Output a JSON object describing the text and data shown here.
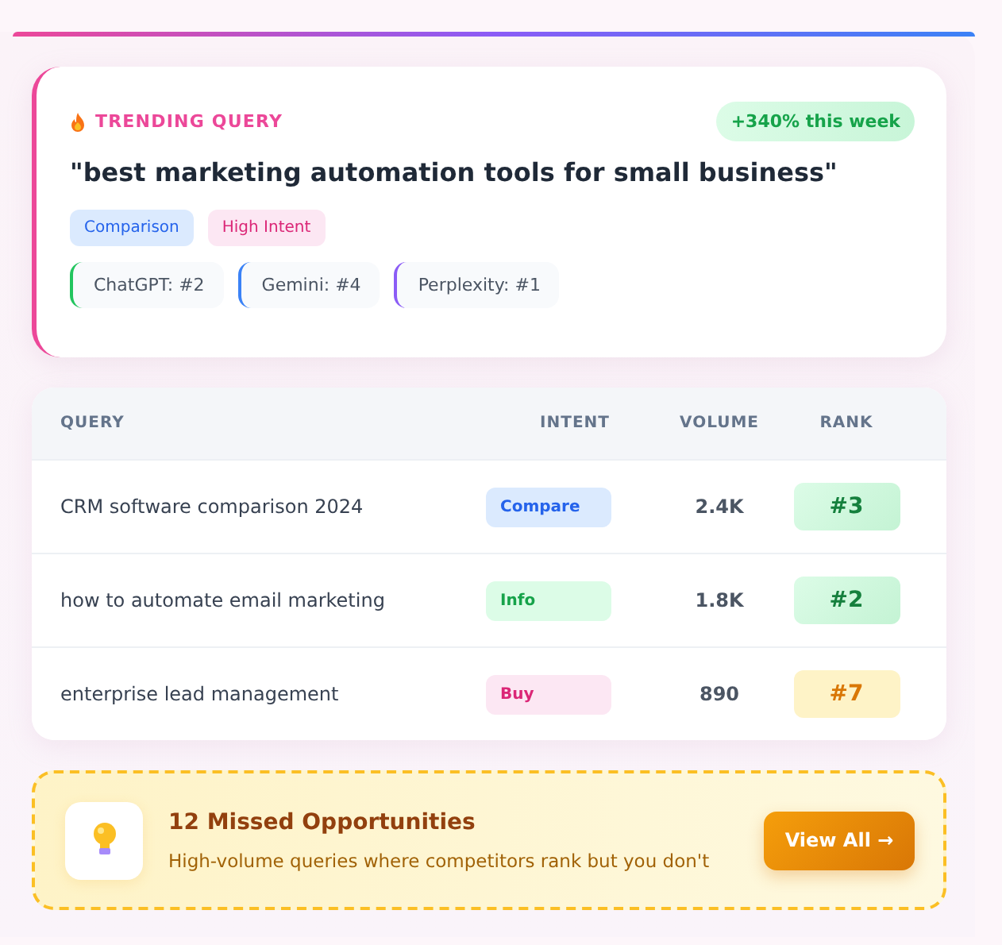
{
  "trending": {
    "label": "TRENDING QUERY",
    "growth": "+340% this week",
    "query": "\"best marketing automation tools for small business\"",
    "tags": [
      {
        "label": "Comparison",
        "kind": "blue"
      },
      {
        "label": "High Intent",
        "kind": "pink"
      }
    ],
    "engines": [
      {
        "label": "ChatGPT: #2",
        "color": "#22c55e"
      },
      {
        "label": "Gemini: #4",
        "color": "#3b82f6"
      },
      {
        "label": "Perplexity: #1",
        "color": "#8b5cf6"
      }
    ]
  },
  "table": {
    "columns": [
      "QUERY",
      "INTENT",
      "VOLUME",
      "RANK"
    ],
    "rows": [
      {
        "query": "CRM software comparison 2024",
        "intent": {
          "label": "Compare",
          "kind": "blue"
        },
        "volume": "2.4K",
        "rank": {
          "label": "#3",
          "kind": "good"
        }
      },
      {
        "query": "how to automate email marketing",
        "intent": {
          "label": "Info",
          "kind": "green"
        },
        "volume": "1.8K",
        "rank": {
          "label": "#2",
          "kind": "good"
        }
      },
      {
        "query": "enterprise lead management",
        "intent": {
          "label": "Buy",
          "kind": "pink"
        },
        "volume": "890",
        "rank": {
          "label": "#7",
          "kind": "warn"
        }
      }
    ]
  },
  "opportunities": {
    "title": "12 Missed Opportunities",
    "text": "High-volume queries where competitors rank but you don't",
    "button": "View All →"
  }
}
